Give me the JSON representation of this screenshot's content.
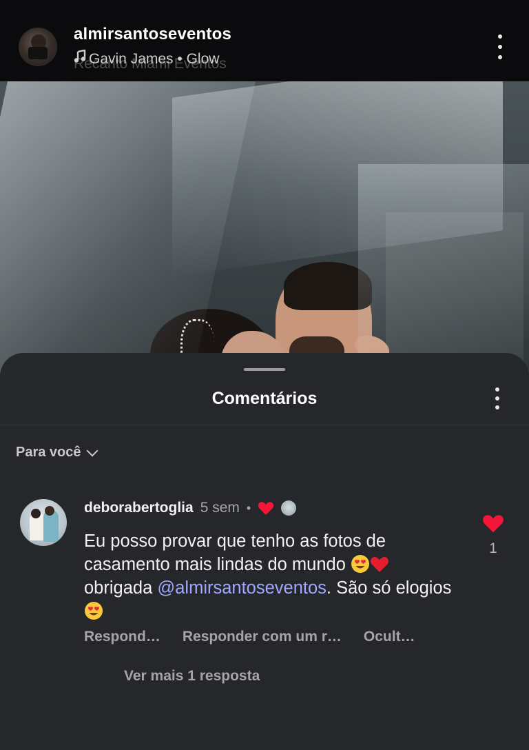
{
  "post_header": {
    "username": "almirsantoseventos",
    "location": "Recanto Miami Eventos",
    "music": "Gavin James • Glow",
    "music_icon": "music-note-icon",
    "menu_icon": "more-vertical-icon"
  },
  "photo": {
    "subject": "wedding-kiss-photo"
  },
  "comments_sheet": {
    "title": "Comentários",
    "menu_icon": "more-vertical-icon",
    "filter_label": "Para você",
    "filter_icon": "chevron-down-icon",
    "comments": [
      {
        "username": "deborabertoglia",
        "time": "5 sem",
        "separator": "•",
        "creator_liked": true,
        "text_part1": "Eu posso provar que tenho as fotos de casamento mais lindas do mundo",
        "text_part2": "obrigada",
        "mention": "@almirsantoseventos",
        "text_part3": ". São só elogios",
        "like_count": "1",
        "actions": {
          "reply": "Respond…",
          "reply_with": "Responder com um r…",
          "hide": "Ocult…"
        },
        "more_replies": "Ver mais 1 resposta"
      }
    ]
  },
  "colors": {
    "accent_heart": "#f4173a",
    "mention": "#9fa8ff",
    "sheet_bg": "#25272b"
  }
}
